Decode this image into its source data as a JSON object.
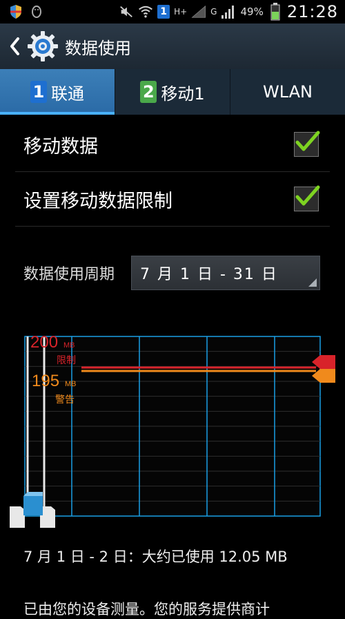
{
  "status_bar": {
    "left_icons": [
      "shield-icon",
      "qq-penguin-icon"
    ],
    "sim_slot": "1",
    "network_label": "H+",
    "network_label_2": "G",
    "battery_percent": "49%",
    "time": "21:28"
  },
  "action_bar": {
    "title": "数据使用"
  },
  "tabs": [
    {
      "num": "1",
      "label": "联通",
      "active": true,
      "badge_color": "#1e6fd0"
    },
    {
      "num": "2",
      "label": "移动1",
      "active": false,
      "badge_color": "#4aa84a"
    },
    {
      "num": "",
      "label": "WLAN",
      "active": false
    }
  ],
  "settings": {
    "mobile_data": {
      "label": "移动数据",
      "checked": true
    },
    "data_limit": {
      "label": "设置移动数据限制",
      "checked": true
    }
  },
  "cycle": {
    "label": "数据使用周期",
    "value": "7 月 1 日 - 31 日"
  },
  "chart_data": {
    "type": "line",
    "limit": {
      "value": "200",
      "unit": "MB",
      "label": "限制",
      "color": "#d8232a"
    },
    "warning": {
      "value": "195",
      "unit": "MB",
      "label": "警告",
      "color": "#f08a1c"
    },
    "usage_mb": 12.05,
    "grid": true
  },
  "footer": {
    "usage_text": "7 月 1 日 - 2 日：大约已使用 12.05 MB",
    "note_text": "已由您的设备测量。您的服务提供商计"
  }
}
